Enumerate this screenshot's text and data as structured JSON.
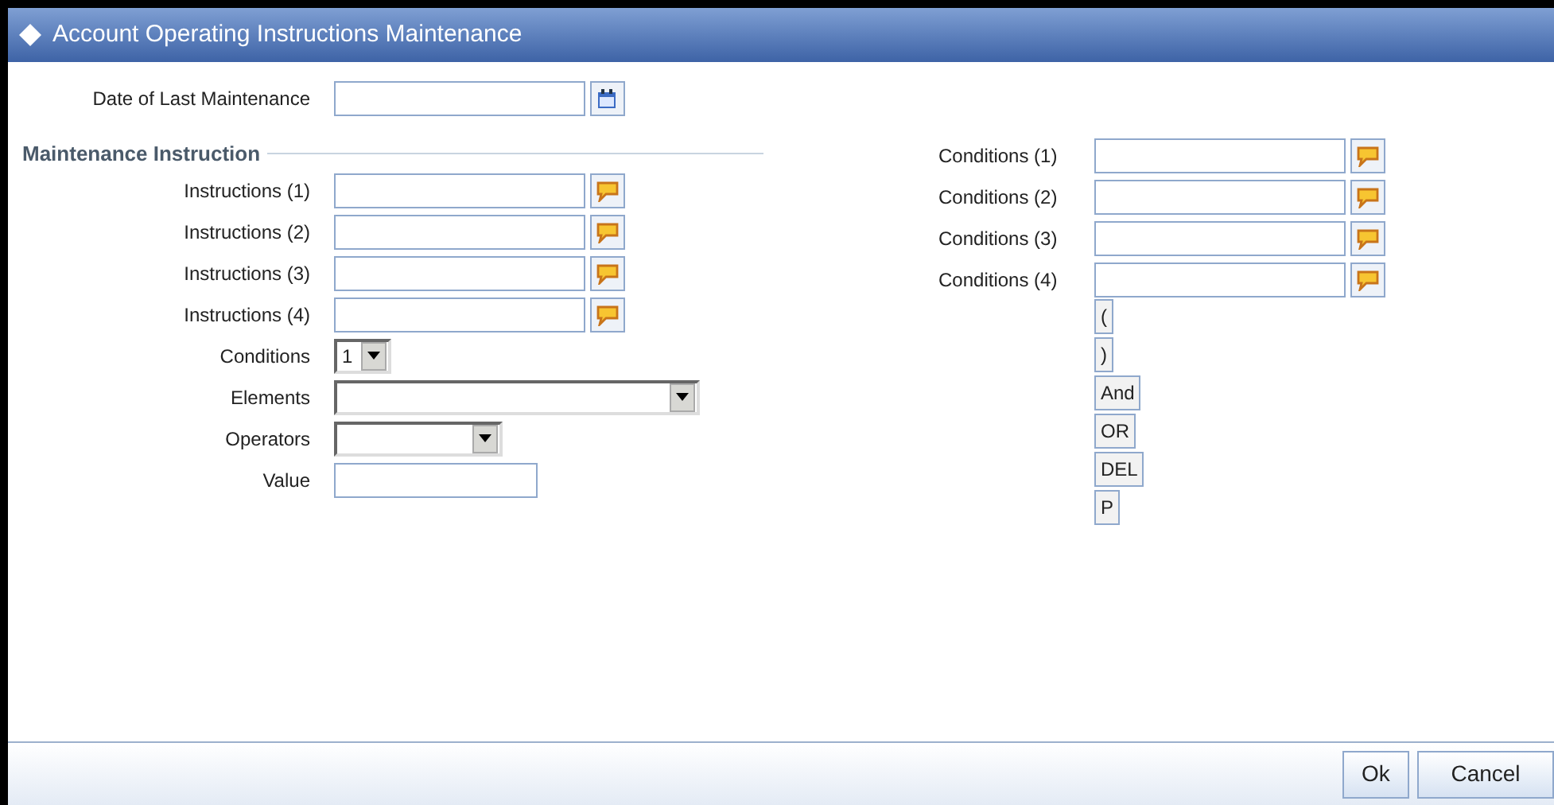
{
  "window": {
    "title": "Account Operating Instructions Maintenance"
  },
  "date_of_last_maintenance": {
    "label": "Date of Last Maintenance"
  },
  "maintenance_instruction": {
    "heading": "Maintenance Instruction",
    "instructions": [
      {
        "label": "Instructions (1)"
      },
      {
        "label": "Instructions (2)"
      },
      {
        "label": "Instructions (3)"
      },
      {
        "label": "Instructions (4)"
      }
    ],
    "selectors": [
      {
        "kind": "small",
        "label": "Conditions",
        "value": "1"
      },
      {
        "kind": "wide",
        "label": "Elements"
      },
      {
        "kind": "medium",
        "label": "Operators"
      }
    ],
    "value_field": {
      "label": "Value"
    }
  },
  "conditions": [
    {
      "label": "Conditions (1)"
    },
    {
      "label": "Conditions (2)"
    },
    {
      "label": "Conditions (3)"
    },
    {
      "label": "Conditions (4)"
    }
  ],
  "operator_buttons": [
    "(",
    ")",
    "And",
    "OR",
    "DEL",
    "P"
  ],
  "footer_buttons": [
    "Ok",
    "Cancel"
  ]
}
